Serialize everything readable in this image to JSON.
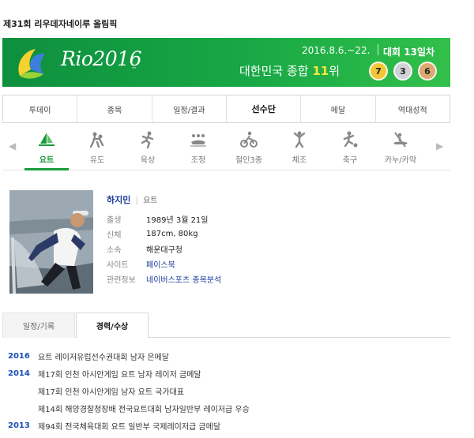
{
  "page": {
    "title": "제31회 리우데자네이루 올림픽"
  },
  "banner": {
    "logo_text": "Rio2016",
    "logo_mark": "™",
    "dates": "2016.8.6.~22.",
    "day": "대회 13일차",
    "rank_prefix": "대한민국 종합 ",
    "rank_value": "11",
    "rank_suffix": "위",
    "medals": {
      "gold": "7",
      "silver": "3",
      "bronze": "6"
    },
    "colors": {
      "green": "#18a845",
      "highlight": "#ffe83a"
    }
  },
  "tabs": [
    "투데이",
    "종목",
    "일정/결과",
    "선수단",
    "메달",
    "역대성적"
  ],
  "sports": [
    {
      "label": "요트",
      "icon": "sailing-icon"
    },
    {
      "label": "유도",
      "icon": "judo-icon"
    },
    {
      "label": "육상",
      "icon": "athletics-icon"
    },
    {
      "label": "조정",
      "icon": "rowing-icon"
    },
    {
      "label": "철인3종",
      "icon": "triathlon-icon"
    },
    {
      "label": "체조",
      "icon": "gymnastics-icon"
    },
    {
      "label": "축구",
      "icon": "football-icon"
    },
    {
      "label": "카누/카약",
      "icon": "canoe-icon"
    }
  ],
  "athlete": {
    "name": "하지민",
    "sport": "요트",
    "info": [
      {
        "key": "출생",
        "value": "1989년 3월 21일"
      },
      {
        "key": "신체",
        "value": "187cm, 80kg"
      },
      {
        "key": "소속",
        "value": "해운대구청"
      },
      {
        "key": "사이트",
        "value": "페이스북"
      },
      {
        "key": "관련정보",
        "value": "네이버스포츠 종목분석"
      }
    ]
  },
  "subtabs": [
    "일정/기록",
    "경력/수상"
  ],
  "career": [
    {
      "year": "2016",
      "text": "요트 레이저유럽선수권대회 남자 은메달"
    },
    {
      "year": "2014",
      "text": "제17회 인천 아시안게임 요트 남자 레이저 금메달"
    },
    {
      "year": "",
      "text": "제17회 인천 아시안게임 남자 요트 국가대표"
    },
    {
      "year": "",
      "text": "제14회 해양경찰청장배 전국요트대회 남자일반부 레이저급 우승"
    },
    {
      "year": "2013",
      "text": "제94회 전국체육대회 요트 일반부 국제레이저급 금메달"
    }
  ]
}
